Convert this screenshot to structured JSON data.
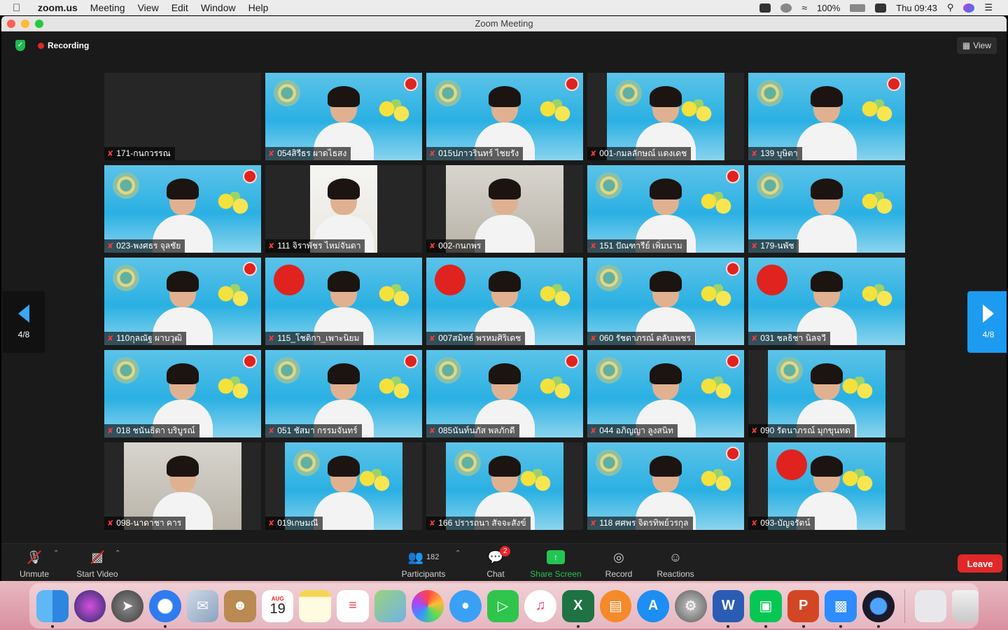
{
  "menubar": {
    "apple": "",
    "app": "zoom.us",
    "items": [
      "Meeting",
      "View",
      "Edit",
      "Window",
      "Help"
    ],
    "battery": "100%",
    "clock": "Thu 09:43"
  },
  "window": {
    "title": "Zoom Meeting",
    "recording_label": "Recording",
    "view_label": "View"
  },
  "pager": {
    "left_label": "4/8",
    "right_label": "4/8"
  },
  "participants": [
    {
      "name": "171-กนกวรรณ",
      "bg": "dark"
    },
    {
      "name": "054สิรีธร ผาดไธสง",
      "bg": "blue"
    },
    {
      "name": "015ปภาวรินทร์ ไชยรัง",
      "bg": "blue"
    },
    {
      "name": "001-กมลลักษณ์ แดงเดช",
      "bg": "blue"
    },
    {
      "name": "139 บุษิตา",
      "bg": "blue"
    },
    {
      "name": "023-พงศธร จุลชัย",
      "bg": "blue"
    },
    {
      "name": "111 จิราพัชร ไหม่จันดา",
      "bg": "white"
    },
    {
      "name": "002-กนกพร",
      "bg": "room"
    },
    {
      "name": "151 ปัณฑารีย์ เพิ่มนาม",
      "bg": "blue"
    },
    {
      "name": "179-นพัช",
      "bg": "blue"
    },
    {
      "name": "110กุลณัฐ ผาบวุฒิ",
      "bg": "blue"
    },
    {
      "name": "115_โชติกา_เพาะนิยม",
      "bg": "blue"
    },
    {
      "name": "007สมิทธ์ พรหมศิริเดช",
      "bg": "blue"
    },
    {
      "name": "060 รัชดาภรณ์ ตลับเพชร",
      "bg": "blue"
    },
    {
      "name": "031 ชลธิชา นิลจวี",
      "bg": "blue"
    },
    {
      "name": "018 ชนันธิดา บริบูรณ์",
      "bg": "blue"
    },
    {
      "name": "051 ชัสมา กรรมจันทร์",
      "bg": "blue"
    },
    {
      "name": "085นันท์นภัส พลภักดี",
      "bg": "blue"
    },
    {
      "name": "044 อภิญญา ลูงสนิท",
      "bg": "blue"
    },
    {
      "name": "090 รัตนาภรณ์ มุกขุนทด",
      "bg": "blue"
    },
    {
      "name": "098-นาดาชา คาร",
      "bg": "room"
    },
    {
      "name": "019เกษมณี",
      "bg": "blue"
    },
    {
      "name": "166 ปรารถนา สัจจะสังข์",
      "bg": "blue"
    },
    {
      "name": "118 ศศพร จิตรทิพย์วรกุล",
      "bg": "blue"
    },
    {
      "name": "093-บัญจรัตน์",
      "bg": "blue"
    }
  ],
  "toolbar": {
    "unmute": "Unmute",
    "start_video": "Start Video",
    "participants_count": "182",
    "participants": "Participants",
    "chat": "Chat",
    "chat_badge": "2",
    "share_screen": "Share Screen",
    "record": "Record",
    "reactions": "Reactions",
    "leave": "Leave"
  },
  "dock": {
    "calendar_month": "AUG",
    "calendar_day": "19",
    "apps": [
      "finder-icon",
      "siri-icon",
      "launchpad-icon",
      "safari-icon",
      "mail-icon",
      "contacts-icon",
      "calendar-icon",
      "notes-icon",
      "reminders-icon",
      "maps-icon",
      "photos-icon",
      "messages-icon",
      "facetime-icon",
      "music-icon",
      "excel-icon",
      "books-icon",
      "app-store-icon",
      "settings-icon",
      "word-icon",
      "line-icon",
      "powerpoint-icon",
      "zoom-icon",
      "quicktime-icon",
      "downloads-icon",
      "trash-icon"
    ]
  },
  "colors": {
    "accent_blue": "#1c9bf0",
    "leave_red": "#e02828",
    "share_green": "#23c552",
    "tile_bg_blue": "#2ab0e3"
  }
}
